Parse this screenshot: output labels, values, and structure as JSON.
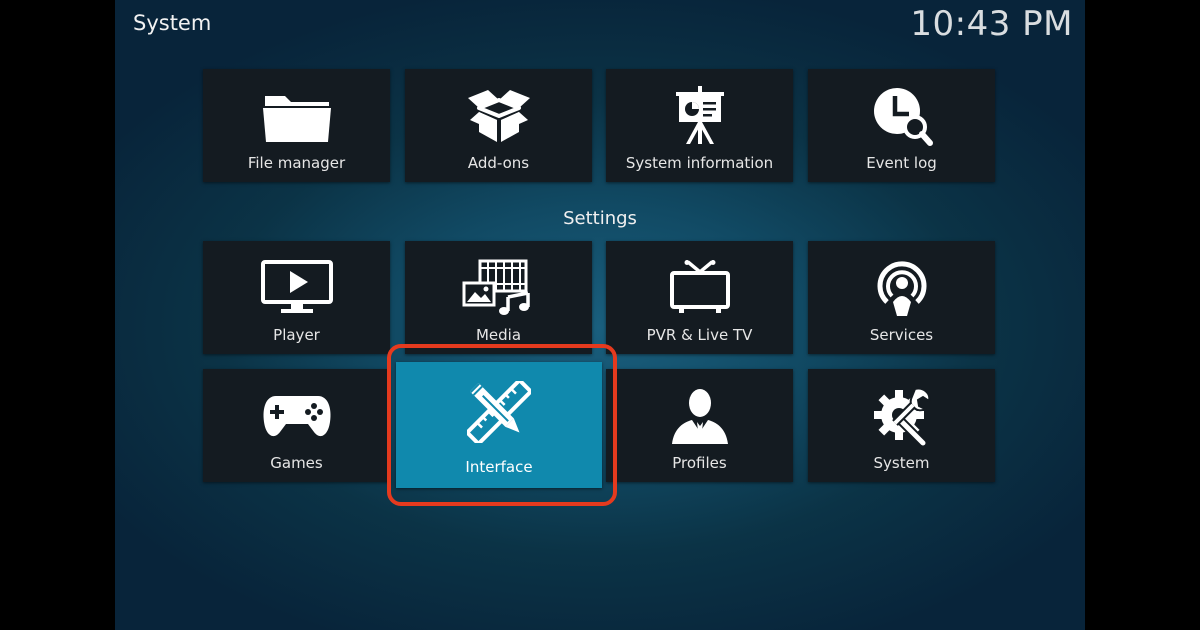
{
  "header": {
    "title": "System",
    "clock": "10:43 PM"
  },
  "top_row": [
    {
      "label": "File manager",
      "icon": "folder-icon"
    },
    {
      "label": "Add-ons",
      "icon": "open-box-icon"
    },
    {
      "label": "System information",
      "icon": "presentation-board-icon"
    },
    {
      "label": "Event log",
      "icon": "clock-magnifier-icon"
    }
  ],
  "settings": {
    "heading": "Settings",
    "items": [
      {
        "label": "Player",
        "icon": "play-monitor-icon"
      },
      {
        "label": "Media",
        "icon": "media-library-icon"
      },
      {
        "label": "PVR & Live TV",
        "icon": "tv-antenna-icon"
      },
      {
        "label": "Services",
        "icon": "broadcast-person-icon"
      },
      {
        "label": "Games",
        "icon": "gamepad-icon"
      },
      {
        "label": "Interface",
        "icon": "pencil-ruler-icon",
        "focused": true
      },
      {
        "label": "Profiles",
        "icon": "person-silhouette-icon"
      },
      {
        "label": "System",
        "icon": "gear-wrench-icon"
      }
    ]
  },
  "colors": {
    "focus_tile": "#1089ad",
    "tile": "#141b21",
    "annotation_outline": "#e53a1e"
  }
}
